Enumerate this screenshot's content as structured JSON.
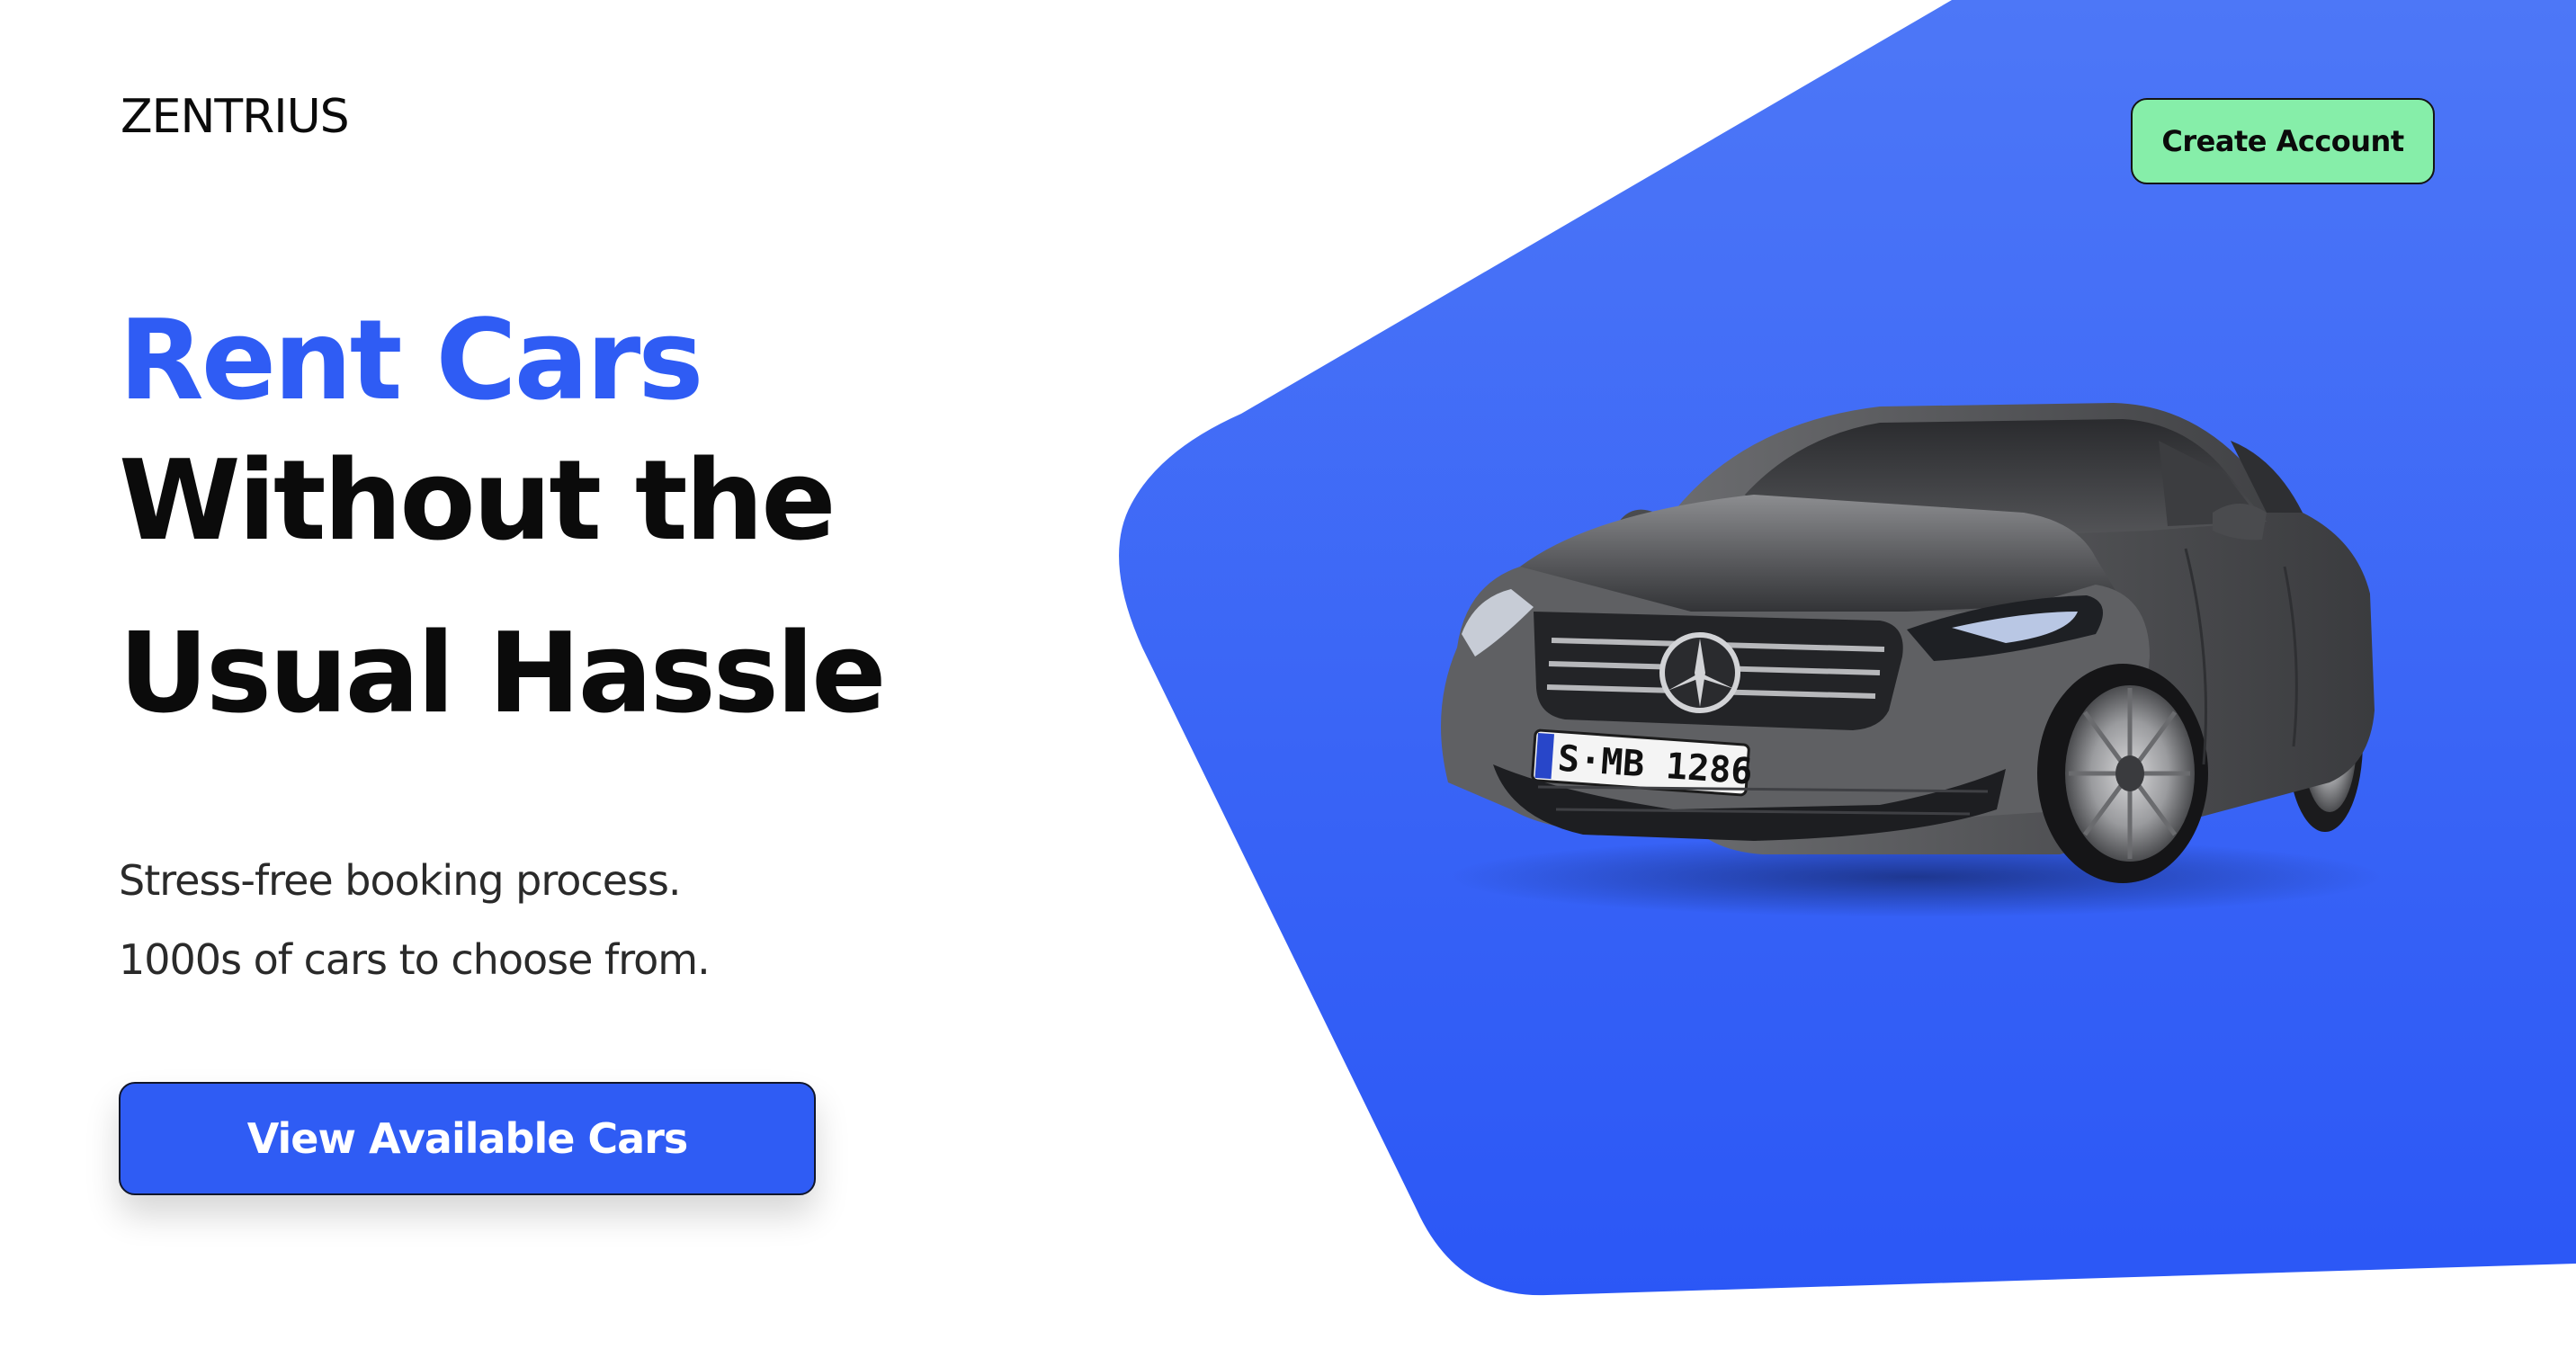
{
  "brand": {
    "logo_text": "ZENTRIUS"
  },
  "header": {
    "create_account_label": "Create Account"
  },
  "hero": {
    "headline_accent": "Rent Cars",
    "headline_line2": "Without the",
    "headline_line3": "Usual Hassle",
    "subline_1": "Stress-free booking process.",
    "subline_2": "1000s of cars to choose from.",
    "cta_label": "View Available Cars",
    "car_plate_text": "S·MB 1286"
  },
  "colors": {
    "accent_blue": "#2f5cf4",
    "shape_blue_light": "#4d77f7",
    "shape_blue_dark": "#2b57f6",
    "create_account_green": "#86eea9",
    "text_dark": "#0b0b0b"
  },
  "icons": {
    "car_image": "car-photo"
  }
}
